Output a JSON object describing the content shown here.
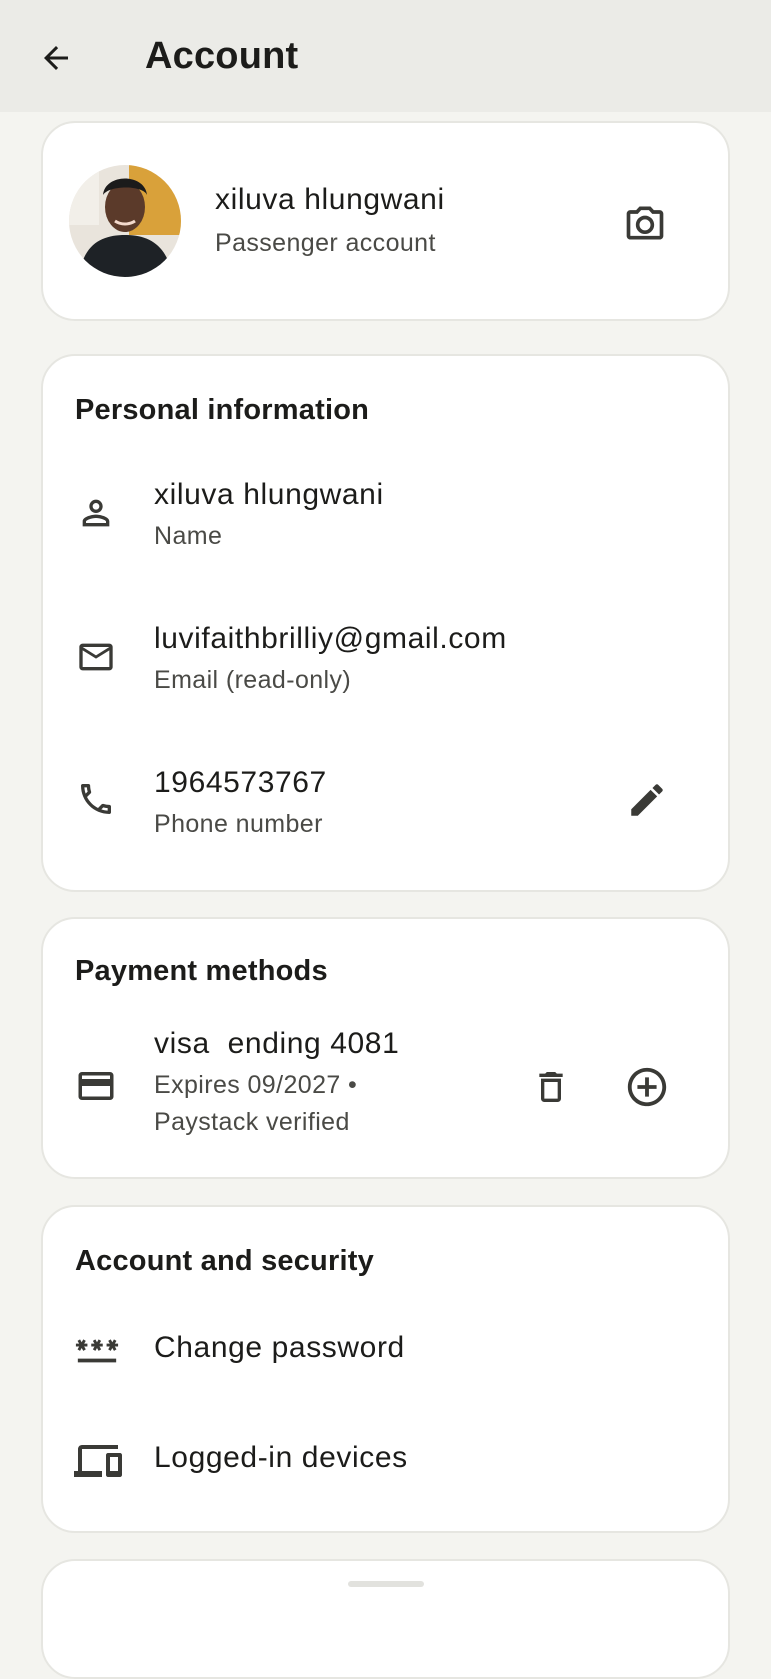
{
  "header": {
    "title": "Account",
    "back_icon": "arrow-back-icon"
  },
  "profile": {
    "name": "xiluva hlungwani",
    "subtitle": "Passenger account",
    "camera_icon": "camera-icon"
  },
  "personal_info": {
    "heading": "Personal information",
    "name_value": "xiluva hlungwani",
    "name_label": "Name",
    "email_value": "luvifaithbrilliy@gmail.com",
    "email_label": "Email (read-only)",
    "phone_value": "1964573767",
    "phone_label": "Phone number"
  },
  "payment": {
    "heading": "Payment methods",
    "card_title": "visa  ending 4081",
    "expires": "Expires 09/2027 •",
    "verified": "Paystack verified"
  },
  "security": {
    "heading": "Account and security",
    "change_password": "Change password",
    "logged_in_devices": "Logged-in devices"
  },
  "colors": {
    "background": "#f4f4f0",
    "topbar": "#ebebe7",
    "card": "#ffffff",
    "text_primary": "#1c1c1a",
    "text_secondary": "#4a4a46"
  }
}
